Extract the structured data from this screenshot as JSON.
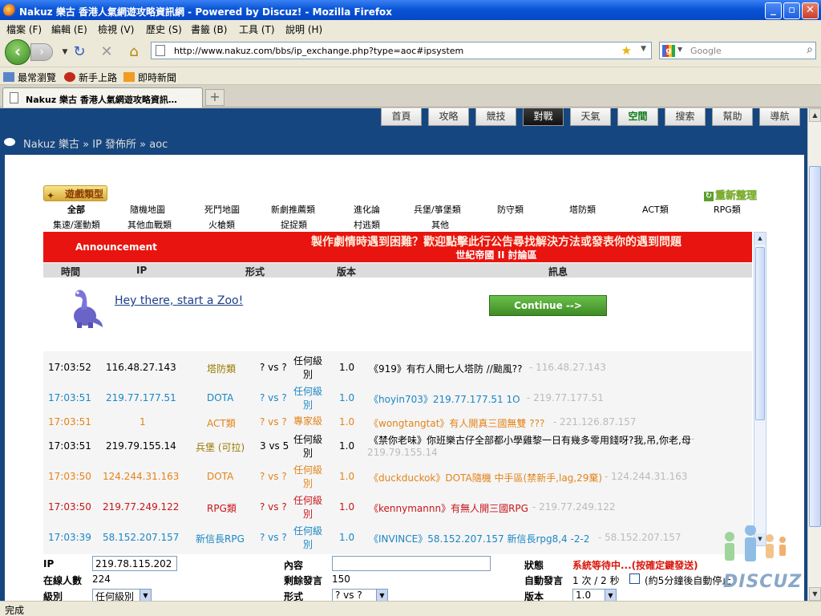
{
  "window": {
    "title": "Nakuz 樂古 香港人氣網遊攻略資訊網 - Powered by Discuz! - Mozilla Firefox",
    "buttons": {
      "minimize": "_",
      "maximize": "▫",
      "close": "✕"
    }
  },
  "menubar": [
    "檔案 (F)",
    "編輯 (E)",
    "檢視 (V)",
    "歷史 (S)",
    "書籤 (B)",
    "工具 (T)",
    "說明 (H)"
  ],
  "navbar": {
    "back_icon": "back-arrow-icon",
    "url": "http://www.nakuz.com/bbs/ip_exchange.php?type=aoc#ipsystem",
    "search_placeholder": "Google",
    "search_engine_label": "g"
  },
  "bookmarks": [
    "最常瀏覽",
    "新手上路",
    "即時新聞"
  ],
  "tabs": [
    {
      "label": "Nakuz 樂古 香港人氣網遊攻略資訊…"
    }
  ],
  "site_nav": [
    "首頁",
    "攻略",
    "競技",
    "對戰",
    "天氣",
    "空間",
    "搜索",
    "幫助",
    "導航"
  ],
  "site_nav_active": 3,
  "breadcrumb": "Nakuz 樂古 » IP 發佈所 » aoc",
  "category": {
    "title": "遊戲類型",
    "refresh": "重新整理",
    "row1": [
      "全部",
      "隨機地圖",
      "死鬥地圖",
      "新劇推薦類",
      "進化論",
      "兵堡/箏堡類",
      "防守類",
      "塔防類",
      "ACT類",
      "RPG類"
    ],
    "row2": [
      "集速/運動類",
      "其他血戰類",
      "火槍類",
      "捉捉類",
      "村逃類",
      "其他"
    ]
  },
  "announcement": {
    "label": "Announcement",
    "message": "製作劇情時遇到困難？歡迎點擊此行公告尋找解決方法或發表你的遇到問題",
    "sub": "世紀帝國 II 討論區"
  },
  "table_headers": [
    "時間",
    "IP",
    "形式",
    "版本",
    "訊息"
  ],
  "ad": {
    "text": "Hey there, start a Zoo!",
    "button": "Continue -->"
  },
  "rows": [
    {
      "time": "17:03:52",
      "ip": "116.48.27.143",
      "type": "塔防類",
      "vs": "? vs ?",
      "level": "任何級別",
      "ver": "1.0",
      "msg": "《919》有冇人開七人塔防 //颱風??",
      "ghost": "- 116.48.27.143",
      "color": "#000000",
      "type_color": "#9a7a00",
      "ip2": ""
    },
    {
      "time": "17:03:51",
      "ip": "219.77.177.51",
      "type": "DOTA",
      "vs": "? vs ?",
      "level": "任何級別",
      "ver": "1.0",
      "msg": "《hoyin703》219.77.177.51 1O",
      "ghost": "- 219.77.177.51",
      "color": "#1a86c4",
      "type_color": "#1a86c4",
      "ip2": ""
    },
    {
      "time": "17:03:51",
      "ip": "1",
      "type": "ACT類",
      "vs": "? vs ?",
      "level": "專家級",
      "ver": "1.0",
      "msg": "《wongtangtat》有人開真三國無雙 ???",
      "ghost": "- 221.126.87.157",
      "color": "#e3831a",
      "type_color": "#000000",
      "ip2": ""
    },
    {
      "time": "17:03:51",
      "ip": "219.79.155.14",
      "type": "兵堡 (可拉)",
      "vs": "3 vs 5",
      "level": "任何級別",
      "ver": "1.0",
      "msg": "《禁你老味》你班樂古仔全部都小學雞黎一日有幾多零用錢呀?我,吊,你老,母",
      "ghost": "-",
      "color": "#000000",
      "type_color": "#9a7a00",
      "ip2": "219.79.155.14"
    },
    {
      "time": "17:03:50",
      "ip": "124.244.31.163",
      "type": "DOTA",
      "vs": "? vs ?",
      "level": "任何級別",
      "ver": "1.0",
      "msg": "《duckduckok》DOTA隨機 中手區(禁新手,lag,29棄)",
      "ghost": "- 124.244.31.163",
      "color": "#e3831a",
      "type_color": "#000000",
      "ip2": ""
    },
    {
      "time": "17:03:50",
      "ip": "219.77.249.122",
      "type": "RPG類",
      "vs": "? vs ?",
      "level": "任何級別",
      "ver": "1.0",
      "msg": "《kennymannn》有無人開三國RPG",
      "ghost": "- 219.77.249.122",
      "color": "#c8141a",
      "type_color": "#000000",
      "ip2": ""
    },
    {
      "time": "17:03:39",
      "ip": "58.152.207.157",
      "type": "新信長RPG",
      "vs": "? vs ?",
      "level": "任何級別",
      "ver": "1.0",
      "msg": "《INVINCE》58.152.207.157 新信長rpg8,4 -2-2",
      "ghost": "- 58.152.207.157",
      "color": "#1a86c4",
      "type_color": "#9a7a00",
      "ip2": ""
    }
  ],
  "form": {
    "ip_label": "IP",
    "ip_value": "219.78.115.202",
    "online_label": "在線人數",
    "online_value": "224",
    "level_label": "級別",
    "level_value": "任何級別",
    "content_label": "內容",
    "content_value": "",
    "remaining_label": "剩餘發言",
    "remaining_value": "150",
    "form_label": "形式",
    "form_value": "? vs ?",
    "status_label": "狀態",
    "status_value": "系統等待中...(按確定鍵發送)",
    "auto_label": "自動發言",
    "auto_value": "1 次 / 2 秒",
    "auto_note": "(約5分鐘後自動停止)",
    "version_label": "版本",
    "version_value": "1.0"
  },
  "watermark": "DISCUZ",
  "status_bar": "完成"
}
